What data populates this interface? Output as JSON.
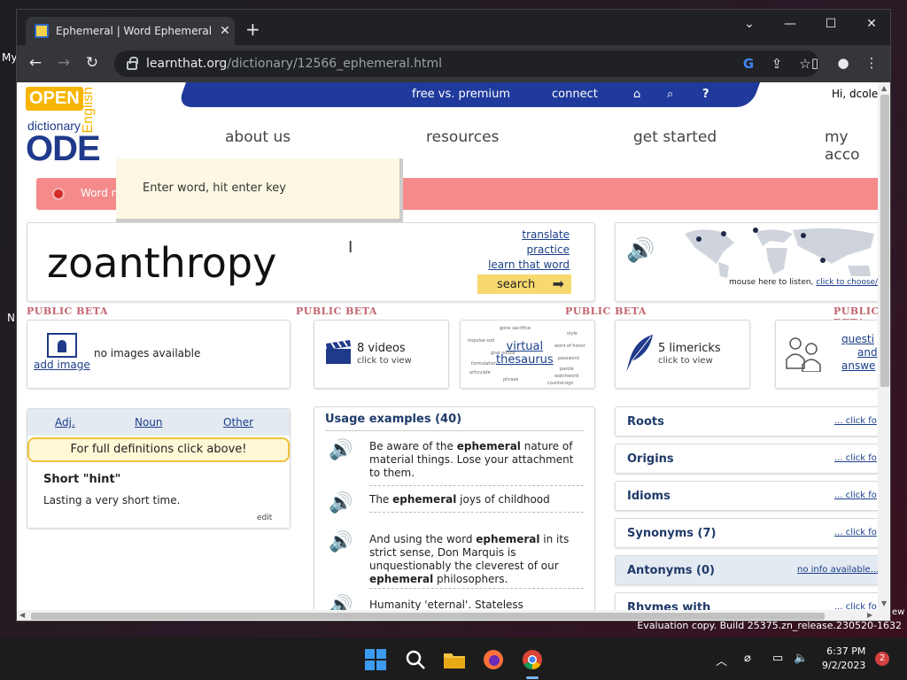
{
  "desktop": {
    "left_text_1": "My",
    "left_text_2": "N",
    "right_text": "ew",
    "evaluation": "Evaluation copy. Build 25375.zn_release.230520-1632"
  },
  "browser": {
    "tab_title": "Ephemeral | Word Ephemeral at C",
    "url_domain": "learnthat.org",
    "url_path": "/dictionary/12566_ephemeral.html"
  },
  "site": {
    "logo": {
      "open": "OPEN",
      "dictionary": "dictionary",
      "ode": "ODE",
      "english": "English"
    },
    "topbar": {
      "free_premium": "free vs. premium",
      "connect": "connect",
      "greeting": "Hi, dcolew"
    },
    "mainnav": [
      "about us",
      "resources",
      "get started",
      "my acco"
    ],
    "redbar_text": "Word n",
    "tooltip": "Enter word, hit enter key",
    "search": {
      "word": "zoanthropy",
      "links": [
        "translate",
        "practice",
        "learn that word"
      ],
      "button": "search"
    },
    "map": {
      "caption_plain": "mouse here to listen, ",
      "caption_link": "click to choose/add"
    },
    "beta_label": "PUBLIC BETA",
    "images": {
      "none": "no images available",
      "add": "add image"
    },
    "videos": {
      "main": "8 videos",
      "sub": "click to view"
    },
    "thesaurus": {
      "line1": "virtual",
      "line2": "thesaurus"
    },
    "limericks": {
      "main": "5 limericks",
      "sub": "click to view"
    },
    "qa": {
      "line1": "questi",
      "line2": "and",
      "line3": "answe"
    },
    "definition": {
      "tabs": [
        "Adj.",
        "Noun",
        "Other"
      ],
      "full": "For full definitions click above!",
      "hint_title": "Short \"hint\"",
      "hint_text": "Lasting a very short time.",
      "edit": "edit"
    },
    "usage": {
      "header": "Usage examples (40)",
      "examples": [
        {
          "pre": "Be aware of the ",
          "bold": "ephemeral",
          "post": " nature of material things. Lose your attachment to them."
        },
        {
          "pre": "The ",
          "bold": "ephemeral",
          "post": " joys of childhood"
        },
        {
          "pre": "And using the word ",
          "bold": "ephemeral",
          "post": " in its strict sense, Don Marquis is unquestionably the cleverest of our ",
          "bold2": "ephemeral",
          "post2": " philosophers."
        },
        {
          "pre": "Humanity 'eternal'. Stateless"
        }
      ]
    },
    "right_links": [
      {
        "label": "Roots",
        "action": "... click fo"
      },
      {
        "label": "Origins",
        "action": "... click fo"
      },
      {
        "label": "Idioms",
        "action": "... click fo"
      },
      {
        "label": "Synonyms (7)",
        "action": "... click fo"
      },
      {
        "label": "Antonyms (0)",
        "action": "no info available..."
      },
      {
        "label": "Rhymes with",
        "action": "... click fo"
      }
    ]
  },
  "taskbar": {
    "time": "6:37 PM",
    "date": "9/2/2023",
    "notifications": "2"
  }
}
